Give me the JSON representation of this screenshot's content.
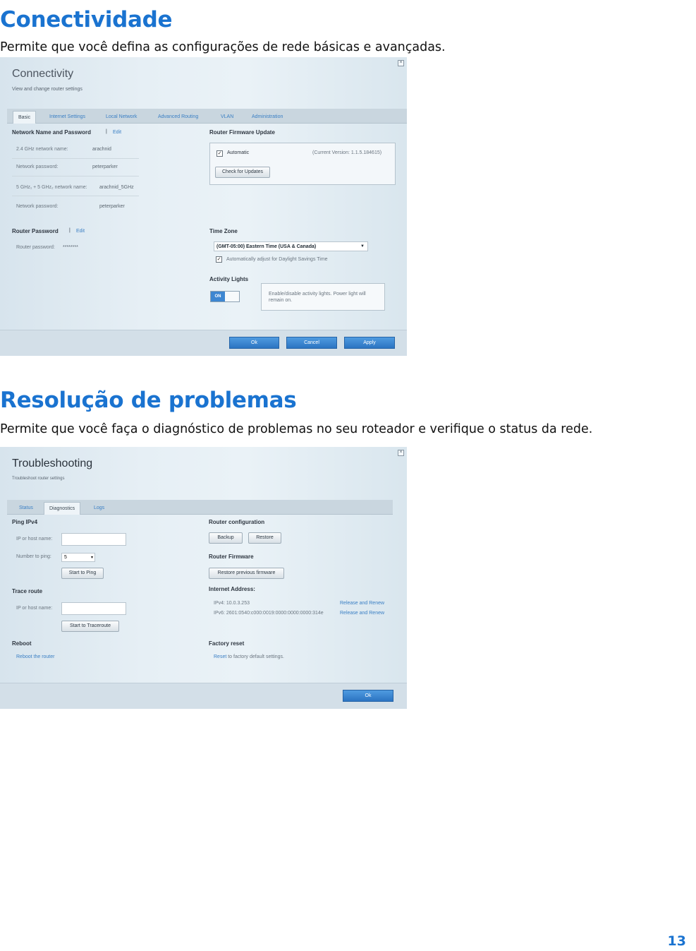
{
  "sections": {
    "connectivity": {
      "heading": "Conectividade",
      "description": "Permite que você defina as configurações de rede básicas e avançadas."
    },
    "troubleshooting": {
      "heading": "Resolução de problemas",
      "description": "Permite que você faça o diagnóstico de problemas no seu roteador e verifique o status da rede."
    }
  },
  "connectivity_panel": {
    "title": "Connectivity",
    "subtitle": "View and change router settings",
    "close_icon": "close-icon",
    "tabs": [
      {
        "label": "Basic",
        "active": true
      },
      {
        "label": "Internet Settings"
      },
      {
        "label": "Local Network"
      },
      {
        "label": "Advanced Routing"
      },
      {
        "label": "VLAN"
      },
      {
        "label": "Administration"
      }
    ],
    "network": {
      "heading": "Network Name and Password",
      "separator": "|",
      "edit": "Edit",
      "rows": [
        {
          "label": "2.4 GHz network name:",
          "value": "arachnid"
        },
        {
          "label": "Network password:",
          "value": "peterparker"
        },
        {
          "label": "5 GHz₁ + 5 GHz₂ network name:",
          "value": "arachnid_5GHz"
        },
        {
          "label": "Network password:",
          "value": "peterparker"
        }
      ]
    },
    "router_password": {
      "heading": "Router Password",
      "separator": "|",
      "edit": "Edit",
      "label": "Router password:",
      "value": "********"
    },
    "firmware": {
      "heading": "Router Firmware Update",
      "automatic_label": "Automatic",
      "automatic_checked": true,
      "current_version": "(Current Version: 1.1.5.184615)",
      "check_button": "Check for Updates"
    },
    "time_zone": {
      "heading": "Time Zone",
      "selected": "(GMT-05:00) Eastern Time (USA & Canada)",
      "dst_label": "Automatically adjust for Daylight Savings Time",
      "dst_checked": true
    },
    "activity_lights": {
      "heading": "Activity Lights",
      "toggle_label": "ON",
      "toggle_on": true,
      "info": "Enable/disable activity lights. Power light will remain on."
    },
    "buttons": {
      "ok": "Ok",
      "cancel": "Cancel",
      "apply": "Apply"
    }
  },
  "troubleshooting_panel": {
    "title": "Troubleshooting",
    "subtitle": "Troubleshoot router settings",
    "close_icon": "close-icon",
    "tabs": [
      {
        "label": "Status"
      },
      {
        "label": "Diagnostics",
        "active": true
      },
      {
        "label": "Logs"
      }
    ],
    "ping": {
      "heading": "Ping IPv4",
      "host_label": "IP or host name:",
      "host_value": "",
      "count_label": "Number to ping:",
      "count_value": "5",
      "start_button": "Start to Ping"
    },
    "trace": {
      "heading": "Trace route",
      "host_label": "IP or host name:",
      "host_value": "",
      "start_button": "Start to Traceroute"
    },
    "reboot": {
      "heading": "Reboot",
      "link": "Reboot the router"
    },
    "router_configuration": {
      "heading": "Router configuration",
      "backup": "Backup",
      "restore": "Restore"
    },
    "router_firmware": {
      "heading": "Router Firmware",
      "restore_previous": "Restore previous firmware"
    },
    "internet_address": {
      "heading": "Internet Address:",
      "ipv4": "IPv4: 10.0.3.253",
      "ipv6": "IPv6: 2601:0540:c000:0019:0000:0000:0000:314e",
      "release_renew": "Release and Renew"
    },
    "factory_reset": {
      "heading": "Factory reset",
      "link": "Reset",
      "text": " to factory default settings."
    },
    "buttons": {
      "ok": "Ok"
    }
  },
  "page_number": "13"
}
